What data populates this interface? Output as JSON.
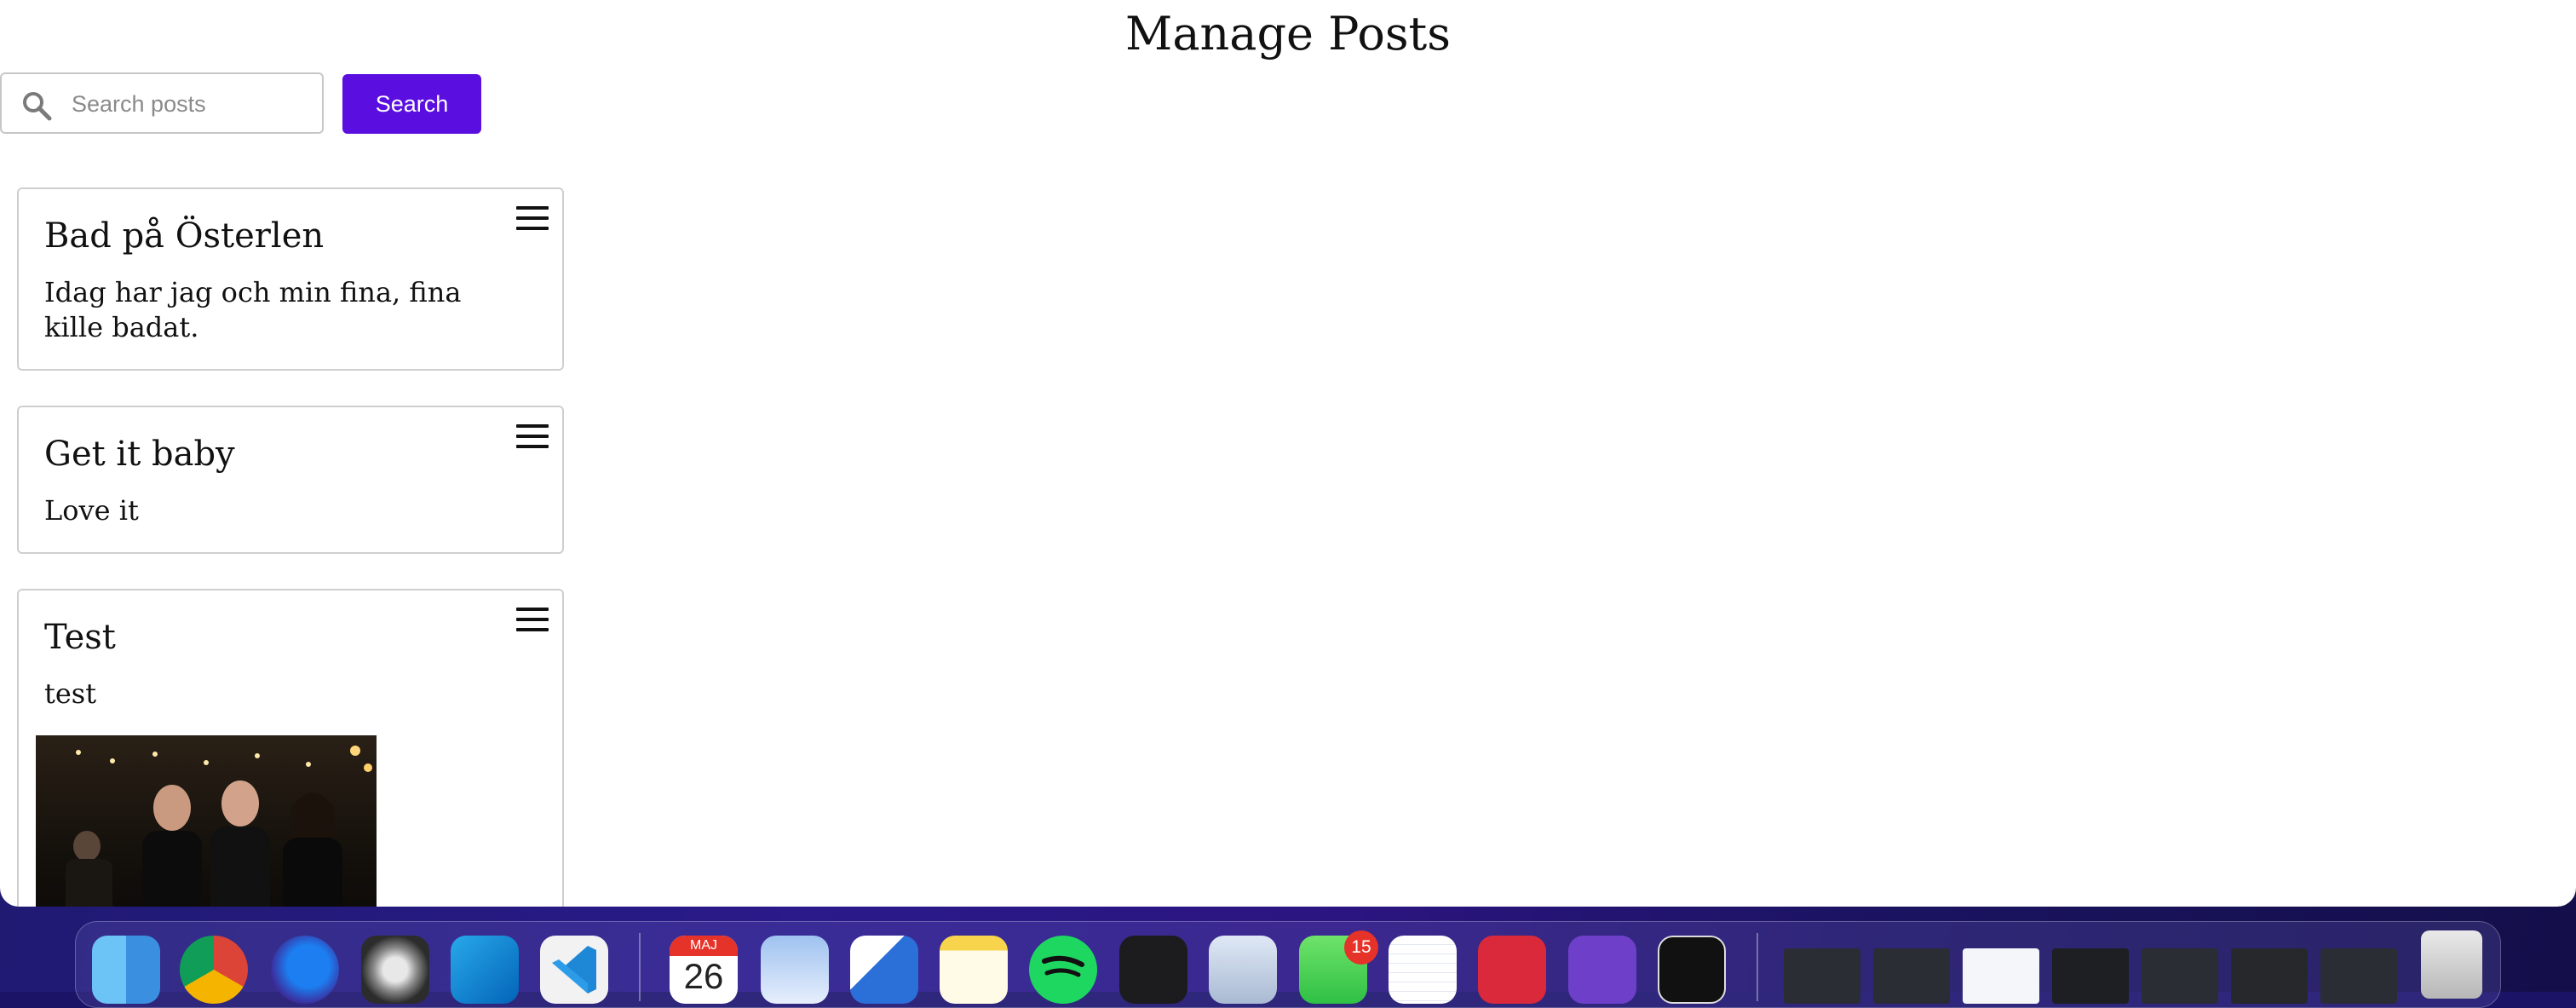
{
  "page": {
    "title": "Manage Posts",
    "search": {
      "placeholder": "Search posts",
      "value": "",
      "button_label": "Search"
    }
  },
  "posts": [
    {
      "title": "Bad på Österlen",
      "body": "Idag har jag och min fina, fina kille badat."
    },
    {
      "title": "Get it baby",
      "body": "Love it"
    },
    {
      "title": "Test",
      "body": "test"
    }
  ],
  "dock": {
    "calendar_month": "MAJ",
    "calendar_day": "26",
    "messages_badge": "15",
    "apps": [
      "Finder",
      "Chrome",
      "Firefox",
      "Compressor",
      "Outlook",
      "VS Code",
      "Calendar",
      "Preview",
      "Word",
      "Notes",
      "Spotify",
      "Apple TV",
      "Disk Utility",
      "Messages",
      "TextEdit",
      "ExpressVPN",
      "GitHub Desktop",
      "Terminal",
      "Trash"
    ]
  },
  "colors": {
    "accent": "#5a0fe0",
    "card_border": "#cfcfcf",
    "dock_bg": "#2a1a8a"
  }
}
